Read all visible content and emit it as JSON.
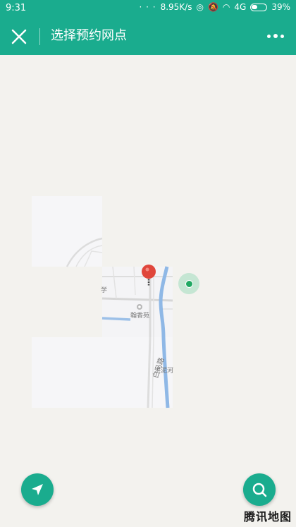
{
  "status_bar": {
    "time": "9:31",
    "dots": "· · ·",
    "speed": "8.95K/s",
    "network": "4G",
    "battery": "39%"
  },
  "title_bar": {
    "title": "选择预约网点",
    "close_icon": "close-icon",
    "more_icon": "more-dots-icon"
  },
  "map": {
    "poi_name": "翰香苑",
    "river_name": "洪泥河",
    "road_name": "白马路",
    "partial_label": "学",
    "pin_icon": "map-pin-icon",
    "location_icon": "current-location-icon"
  },
  "buttons": {
    "locate_icon": "navigation-arrow-icon",
    "search_icon": "search-icon"
  },
  "brand": "腾讯地图",
  "colors": {
    "accent": "#1aac8e",
    "pin": "#e0463b",
    "location": "#20a862",
    "river": "#8fb8e6"
  }
}
